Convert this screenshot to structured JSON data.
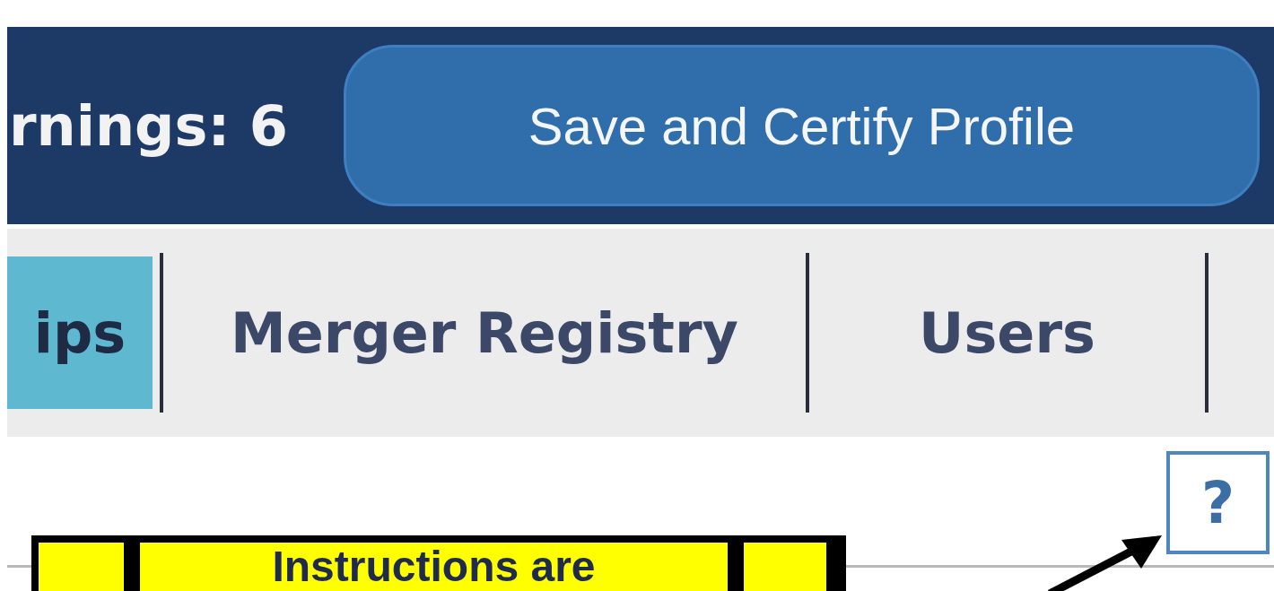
{
  "header": {
    "warnings_label": "rnings: 6",
    "button": "Save and Certify Profile"
  },
  "tabs": [
    {
      "label": "ips",
      "selected": true
    },
    {
      "label": "Merger Registry",
      "selected": false
    },
    {
      "label": "Users",
      "selected": false
    }
  ],
  "help_button": "?",
  "callout": {
    "text": "Instructions are"
  }
}
